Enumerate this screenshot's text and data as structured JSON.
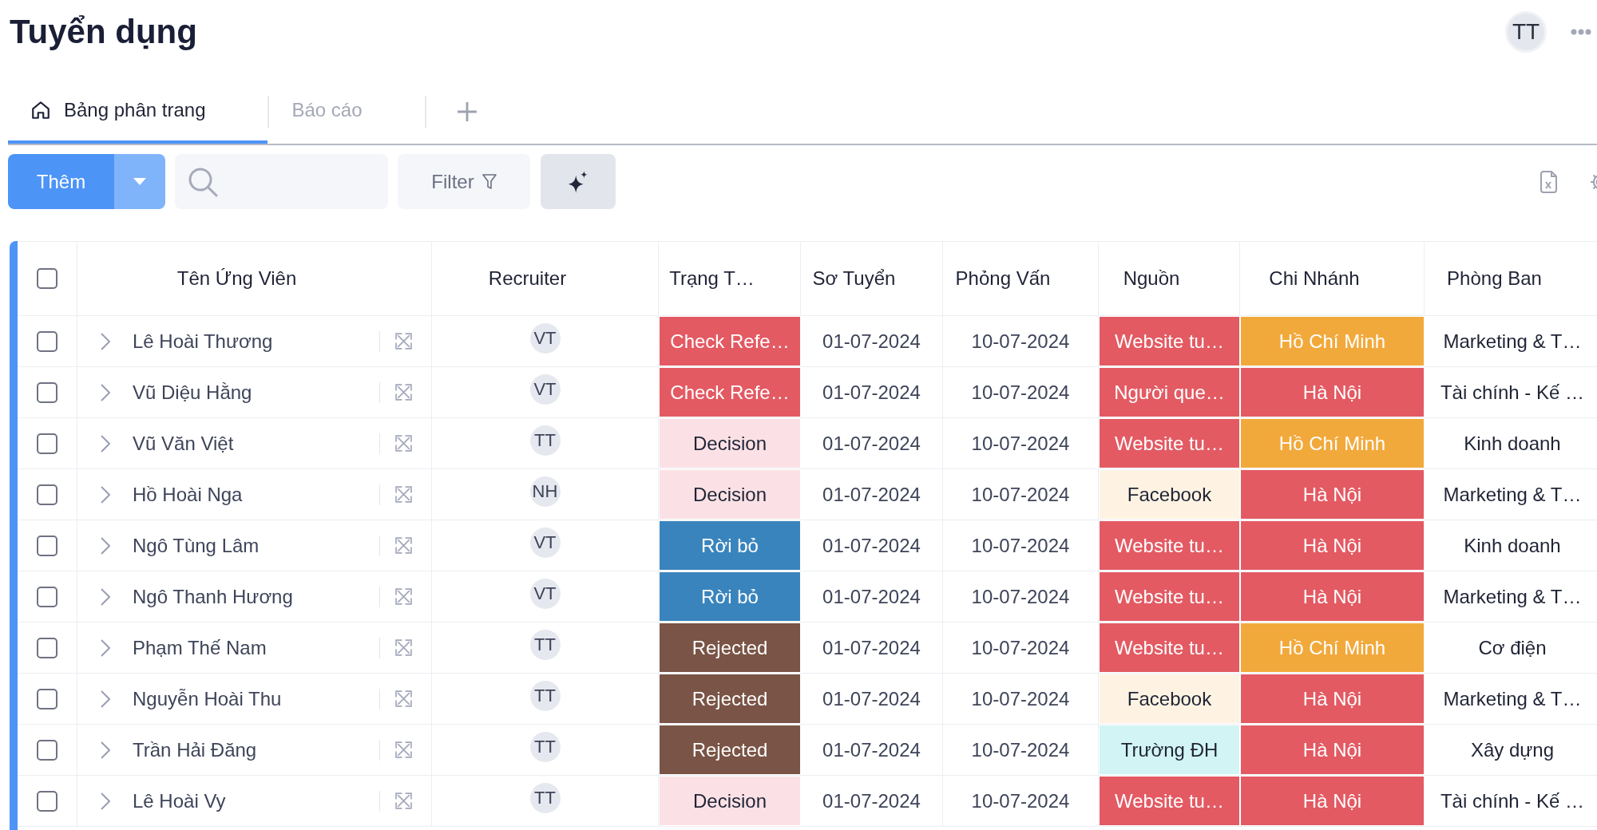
{
  "page": {
    "title": "Tuyển dụng",
    "user_avatar": "TT"
  },
  "tabs": [
    {
      "label": "Bảng phân trang",
      "kind": "home",
      "selected": true
    },
    {
      "label": "Báo cáo",
      "kind": "plain",
      "selected": false
    }
  ],
  "toolbar": {
    "add_button": "Thêm",
    "filter_button": "Filter"
  },
  "table": {
    "select_all_checked": false,
    "columns": [
      "Tên Ứng Viên",
      "Recruiter",
      "Trạng T…",
      "Sơ Tuyển",
      "Phỏng Vấn",
      "Nguồn",
      "Chi Nhánh",
      "Phòng Ban"
    ],
    "rows": [
      {
        "checked": false,
        "expanded": false,
        "name": "Lê Hoài Thương",
        "recruiter": "VT",
        "status": {
          "label": "Check Refe…",
          "color": "#e35a63"
        },
        "screening": "01-07-2024",
        "interview": "10-07-2024",
        "source": {
          "label": "Website tu…",
          "color": "#e35a63"
        },
        "branch": {
          "label": "Hồ Chí Minh",
          "color": "#f2a93b"
        },
        "department": "Marketing & T…"
      },
      {
        "checked": false,
        "expanded": false,
        "name": "Vũ Diệu Hằng",
        "recruiter": "VT",
        "status": {
          "label": "Check Refe…",
          "color": "#e35a63"
        },
        "screening": "01-07-2024",
        "interview": "10-07-2024",
        "source": {
          "label": "Người que…",
          "color": "#e35a63"
        },
        "branch": {
          "label": "Hà Nội",
          "color": "#e35a63"
        },
        "department": "Tài chính - Kế …"
      },
      {
        "checked": false,
        "expanded": false,
        "name": "Vũ Văn Việt",
        "recruiter": "TT",
        "status": {
          "label": "Decision",
          "color": "#fbe1e5"
        },
        "screening": "01-07-2024",
        "interview": "10-07-2024",
        "source": {
          "label": "Website tu…",
          "color": "#e35a63"
        },
        "branch": {
          "label": "Hồ Chí Minh",
          "color": "#f2a93b"
        },
        "department": "Kinh doanh"
      },
      {
        "checked": false,
        "expanded": false,
        "name": "Hồ Hoài Nga",
        "recruiter": "NH",
        "status": {
          "label": "Decision",
          "color": "#fbe1e5"
        },
        "screening": "01-07-2024",
        "interview": "10-07-2024",
        "source": {
          "label": "Facebook",
          "color": "#fef3e2"
        },
        "branch": {
          "label": "Hà Nội",
          "color": "#e35a63"
        },
        "department": "Marketing & T…"
      },
      {
        "checked": false,
        "expanded": false,
        "name": "Ngô Tùng Lâm",
        "recruiter": "VT",
        "status": {
          "label": "Rời bỏ",
          "color": "#3a84bd"
        },
        "screening": "01-07-2024",
        "interview": "10-07-2024",
        "source": {
          "label": "Website tu…",
          "color": "#e35a63"
        },
        "branch": {
          "label": "Hà Nội",
          "color": "#e35a63"
        },
        "department": "Kinh doanh"
      },
      {
        "checked": false,
        "expanded": false,
        "name": "Ngô Thanh Hương",
        "recruiter": "VT",
        "status": {
          "label": "Rời bỏ",
          "color": "#3a84bd"
        },
        "screening": "01-07-2024",
        "interview": "10-07-2024",
        "source": {
          "label": "Website tu…",
          "color": "#e35a63"
        },
        "branch": {
          "label": "Hà Nội",
          "color": "#e35a63"
        },
        "department": "Marketing & T…"
      },
      {
        "checked": false,
        "expanded": false,
        "name": "Phạm Thế Nam",
        "recruiter": "TT",
        "status": {
          "label": "Rejected",
          "color": "#7a5446"
        },
        "screening": "01-07-2024",
        "interview": "10-07-2024",
        "source": {
          "label": "Website tu…",
          "color": "#e35a63"
        },
        "branch": {
          "label": "Hồ Chí Minh",
          "color": "#f2a93b"
        },
        "department": "Cơ điện"
      },
      {
        "checked": false,
        "expanded": false,
        "name": "Nguyễn Hoài Thu",
        "recruiter": "TT",
        "status": {
          "label": "Rejected",
          "color": "#7a5446"
        },
        "screening": "01-07-2024",
        "interview": "10-07-2024",
        "source": {
          "label": "Facebook",
          "color": "#fef3e2"
        },
        "branch": {
          "label": "Hà Nội",
          "color": "#e35a63"
        },
        "department": "Marketing & T…"
      },
      {
        "checked": false,
        "expanded": false,
        "name": "Trần Hải Đăng",
        "recruiter": "TT",
        "status": {
          "label": "Rejected",
          "color": "#7a5446"
        },
        "screening": "01-07-2024",
        "interview": "10-07-2024",
        "source": {
          "label": "Trường ĐH",
          "color": "#d2f4f4"
        },
        "branch": {
          "label": "Hà Nội",
          "color": "#e35a63"
        },
        "department": "Xây dựng"
      },
      {
        "checked": false,
        "expanded": false,
        "name": "Lê Hoài Vy",
        "recruiter": "TT",
        "status": {
          "label": "Decision",
          "color": "#fbe1e5"
        },
        "screening": "01-07-2024",
        "interview": "10-07-2024",
        "source": {
          "label": "Website tu…",
          "color": "#e35a63"
        },
        "branch": {
          "label": "Hà Nội",
          "color": "#e35a63"
        },
        "department": "Tài chính - Kế …"
      }
    ]
  }
}
